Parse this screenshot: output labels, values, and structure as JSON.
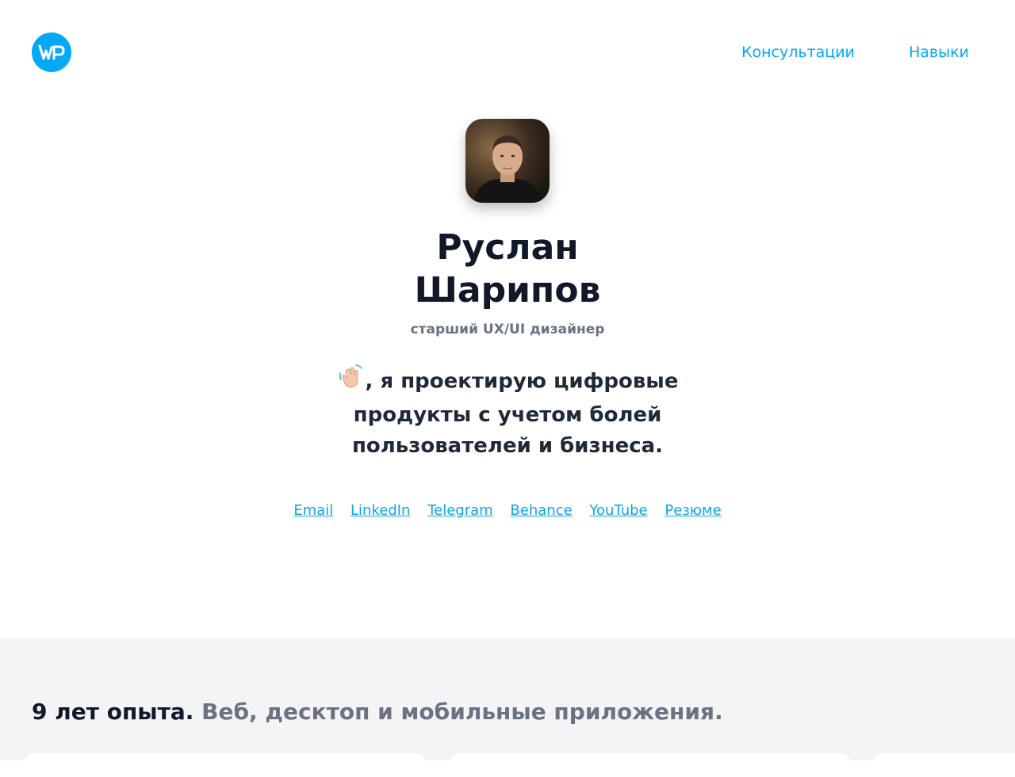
{
  "header": {
    "logo_icon": "wr-monogram-logo",
    "nav": [
      {
        "label": "Консультации"
      },
      {
        "label": "Навыки"
      }
    ]
  },
  "profile": {
    "name_line1": "Руслан",
    "name_line2": "Шарипов",
    "role": "старший UX/UI дизайнер",
    "intro_icon": "waving-hand-icon",
    "intro": ", я проектирую цифровые продукты с учетом болей пользователей и бизнеса."
  },
  "links": [
    {
      "label": "Email"
    },
    {
      "label": "LinkedIn"
    },
    {
      "label": "Telegram"
    },
    {
      "label": "Behance"
    },
    {
      "label": "YouTube"
    },
    {
      "label": "Резюме"
    }
  ],
  "experience": {
    "strong": "9 лет опыта.",
    "muted": "Веб, десктоп и мобильные приложения."
  },
  "colors": {
    "accent": "#03a9f4",
    "link": "#0ea5e9",
    "section_bg": "#f4f4f6"
  }
}
